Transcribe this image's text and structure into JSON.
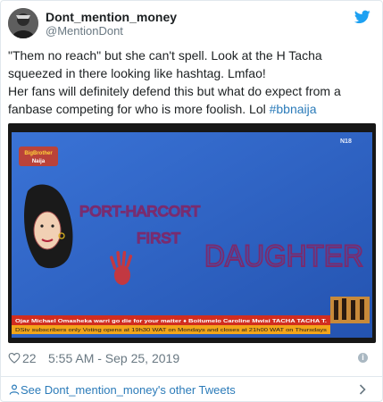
{
  "user": {
    "display_name": "Dont_mention_money",
    "handle": "@MentionDont"
  },
  "tweet": {
    "line1": "\"Them no reach\" but she can't spell. Look at the H Tacha",
    "line2": "squeezed in there looking like hashtag. Lmfao!",
    "line3": "Her fans will definitely defend this but what do expect from a",
    "line4_prefix": "fanbase competing for who is more foolish. Lol ",
    "hashtag": "#bbnaija"
  },
  "media": {
    "show_logo_line1": "BigBrother",
    "show_logo_line2": "Naija",
    "channel_bug": "N18",
    "painted_line1": "PORT-HARCORT",
    "painted_line2": "FIRST",
    "painted_line3": "DAUGHTER",
    "ticker_line1": "Ojaz Michael Omasheka warri go die for your matter   ♦ Boitumelo Caroline Mwisi TACHA TACHA T.",
    "ticker_line2": "DStv subscribers only   Voting opens at 19h30 WAT on Mondays and closes at 21h00 WAT on Thursdays"
  },
  "footer": {
    "likes": "22",
    "timestamp": "5:55 AM - Sep 25, 2019",
    "info_glyph": "i"
  },
  "more_tweets_label": "See Dont_mention_money's other Tweets",
  "colors": {
    "link": "#2b7bb9",
    "muted": "#697882",
    "twitter_blue": "#1da1f2",
    "screen_blue": "#2f64c8",
    "paint_purple": "#7a2b6e"
  }
}
